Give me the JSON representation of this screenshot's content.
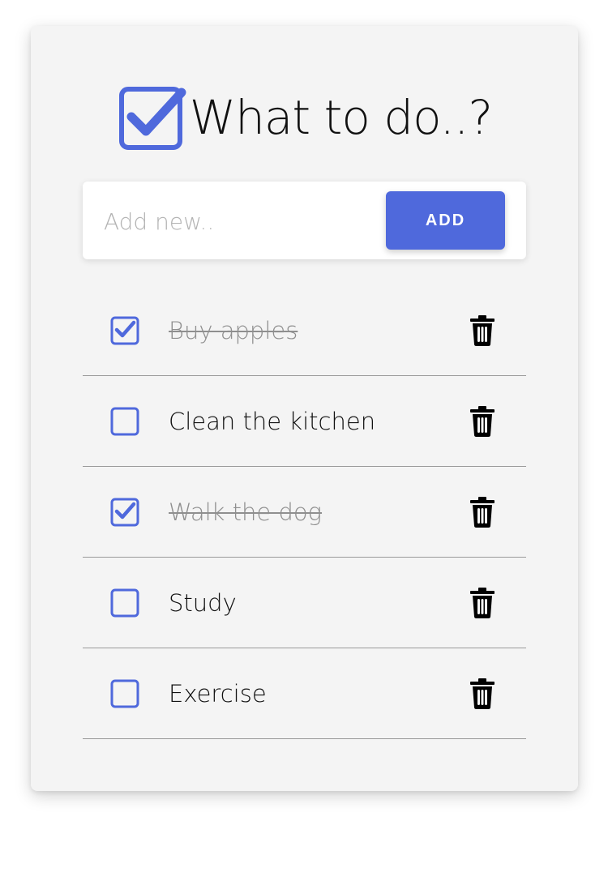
{
  "header": {
    "title": "What to do..?",
    "logo_icon": "checkbox-checked-icon"
  },
  "add_bar": {
    "placeholder": "Add new..",
    "value": "",
    "button_label": "ADD"
  },
  "todos": [
    {
      "text": "Buy apples",
      "done": true
    },
    {
      "text": "Clean the kitchen",
      "done": false
    },
    {
      "text": "Walk the dog",
      "done": true
    },
    {
      "text": "Study",
      "done": false
    },
    {
      "text": "Exercise",
      "done": false
    }
  ],
  "icons": {
    "checkbox": "checkbox-icon",
    "delete": "trash-icon"
  },
  "colors": {
    "accent": "#4f69dc",
    "card_background": "#f4f4f4",
    "done_text": "#8f8f8f"
  }
}
